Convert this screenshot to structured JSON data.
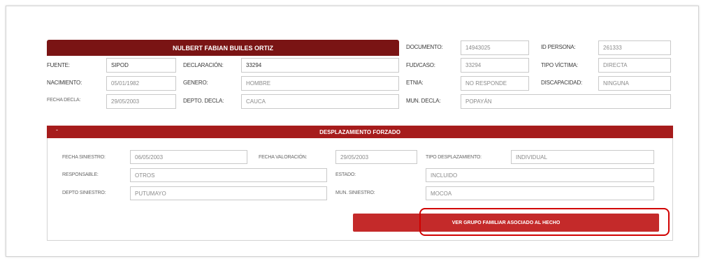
{
  "person": {
    "name": "NULBERT FABIAN BUILES ORTIZ",
    "documento_label": "DOCUMENTO:",
    "documento_value": "14943025",
    "id_persona_label": "ID PERSONA:",
    "id_persona_value": "261333",
    "fuente_label": "FUENTE:",
    "fuente_value": "SIPOD",
    "declaracion_label": "DECLARACIÓN:",
    "declaracion_value": "33294",
    "fud_label": "FUD/CASO:",
    "fud_value": "33294",
    "tipo_victima_label": "TIPO VÍCTIMA:",
    "tipo_victima_value": "DIRECTA",
    "nacimiento_label": "NACIMIENTO:",
    "nacimiento_value": "05/01/1982",
    "genero_label": "GENERO:",
    "genero_value": "HOMBRE",
    "etnia_label": "ETNIA:",
    "etnia_value": "NO RESPONDE",
    "discapacidad_label": "DISCAPACIDAD:",
    "discapacidad_value": "NINGUNA",
    "fecha_decla_label": "FECHA DECLA:",
    "fecha_decla_value": "29/05/2003",
    "depto_decla_label": "DEPTO. DECLA:",
    "depto_decla_value": "CAUCA",
    "mun_decla_label": "MUN. DECLA:",
    "mun_decla_value": "POPAYÁN"
  },
  "displacement": {
    "header": "DESPLAZAMIENTO FORZADO",
    "dash": "-",
    "fecha_siniestro_label": "FECHA SINIESTRO:",
    "fecha_siniestro_value": "06/05/2003",
    "fecha_valoracion_label": "FECHA VALORACIÓN:",
    "fecha_valoracion_value": "29/05/2003",
    "tipo_desplazamiento_label": "TIPO DESPLAZAMIENTO:",
    "tipo_desplazamiento_value": "INDIVIDUAL",
    "responsable_label": "RESPONSABLE:",
    "responsable_value": "OTROS",
    "estado_label": "ESTADO:",
    "estado_value": "INCLUIDO",
    "depto_siniestro_label": "DEPTO SINIESTRO:",
    "depto_siniestro_value": "PUTUMAYO",
    "mun_siniestro_label": "MUN. SINIESTRO:",
    "mun_siniestro_value": "MOCOA",
    "button_label": "VER GRUPO FAMILIAR ASOCIADO AL HECHO"
  },
  "colors": {
    "name_bar": "#7a1414",
    "panel_header": "#a61c1c",
    "button": "#c42a2a",
    "highlight": "#d10000"
  }
}
